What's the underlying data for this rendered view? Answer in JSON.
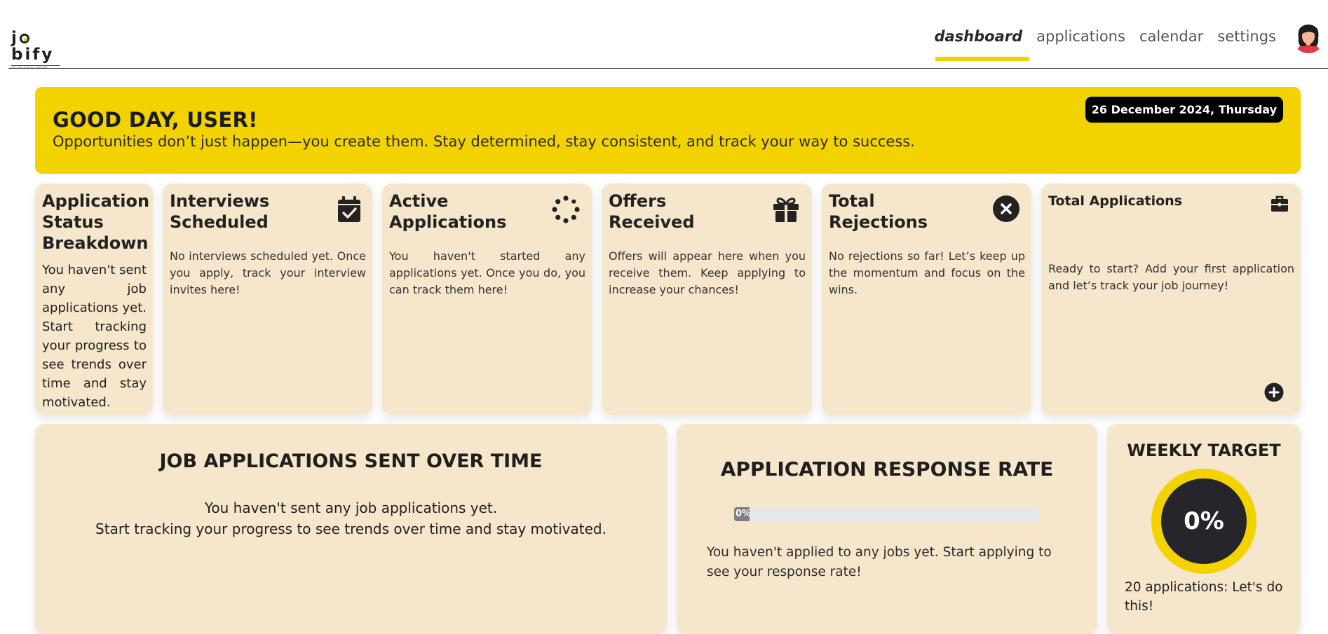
{
  "nav": {
    "logo_text": "jobify",
    "logo_tagline": "JOB APPLICATION TRACKER",
    "links": [
      "dashboard",
      "applications",
      "calendar",
      "settings"
    ],
    "active_link": "dashboard"
  },
  "banner": {
    "title": "GOOD DAY, USER!",
    "subtitle": "Opportunities don’t just happen—you create them. Stay determined, stay consistent, and track your way to success.",
    "date": "26 December 2024, Thursday"
  },
  "cards": {
    "status_breakdown": {
      "title": "Application Status Breakdown",
      "body": "You haven't sent any job applications yet. Start tracking your progress to see trends over time and stay motivated."
    },
    "interviews": {
      "title": "Interviews Scheduled",
      "body": "No interviews scheduled yet. Once you apply, track your interview invites here!",
      "icon": "calendar-check-icon"
    },
    "active": {
      "title": "Active Applications",
      "body": "You haven't started any applications yet. Once you do, you can track them here!",
      "icon": "spinner-icon"
    },
    "offers": {
      "title": "Offers Received",
      "body": "Offers will appear here when you receive them. Keep applying to increase your chances!",
      "icon": "gift-icon"
    },
    "rejections": {
      "title": "Total Rejections",
      "body": "No rejections so far! Let’s keep up the momentum and focus on the wins.",
      "icon": "x-circle-icon"
    },
    "total": {
      "title": "Total Applications",
      "body": "Ready to start? Add your first application and let’s track your job journey!",
      "icon": "briefcase-icon",
      "add_icon": "plus-circle-icon"
    }
  },
  "panels": {
    "over_time": {
      "title": "JOB APPLICATIONS SENT OVER TIME",
      "line1": "You haven't sent any job applications yet.",
      "line2": "Start tracking your progress to see trends over time and stay motivated."
    },
    "response_rate": {
      "title": "APPLICATION RESPONSE RATE",
      "progress_label": "0%",
      "progress_fraction": 0.0,
      "message": "You haven't applied to any jobs yet. Start applying to see your response rate!"
    },
    "weekly_target": {
      "title": "WEEKLY TARGET",
      "percent_label": "0%",
      "message": "20 applications: Let's do this!"
    }
  },
  "colors": {
    "accent": "#f2d300",
    "card_bg": "#f5e6cc",
    "dark": "#25252b"
  }
}
